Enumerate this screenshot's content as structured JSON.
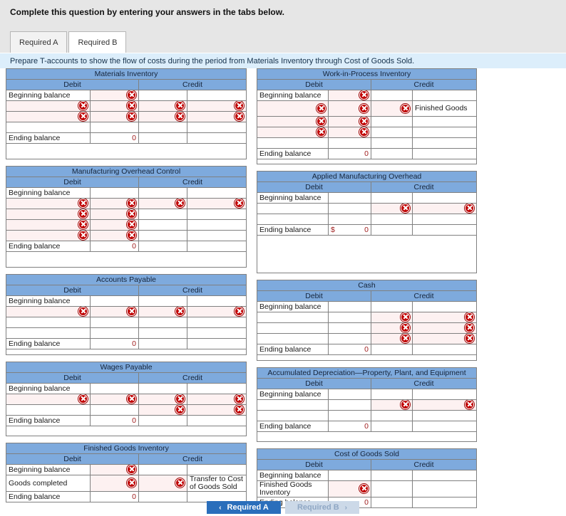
{
  "header": {
    "title": "Complete this question by entering your answers in the tabs below."
  },
  "tabs": [
    {
      "label": "Required A",
      "active": false
    },
    {
      "label": "Required B",
      "active": true
    }
  ],
  "instruction": {
    "text": "Prepare T-accounts to show the flow of costs during the period from Materials Inventory through Cost of Goods Sold."
  },
  "labels": {
    "debit": "Debit",
    "credit": "Credit",
    "beginning_balance": "Beginning balance",
    "ending_balance": "Ending balance",
    "zero": "0",
    "dollar": "$",
    "finished_goods": "Finished Goods",
    "goods_completed": "Goods completed",
    "transfer_to_cogs": "Transfer to Cost of Goods Sold",
    "finished_goods_inventory": "Finished Goods Inventory",
    "empty": ""
  },
  "accounts": {
    "materials_inventory": {
      "title": "Materials Inventory"
    },
    "work_in_process": {
      "title": "Work-in-Process Inventory"
    },
    "mfg_oh_control": {
      "title": "Manufacturing Overhead Control"
    },
    "applied_mfg_oh": {
      "title": "Applied Manufacturing Overhead"
    },
    "accounts_payable": {
      "title": "Accounts Payable"
    },
    "cash": {
      "title": "Cash"
    },
    "wages_payable": {
      "title": "Wages Payable"
    },
    "accum_depr": {
      "title": "Accumulated Depreciation—Property, Plant, and Equipment"
    },
    "finished_goods_inv": {
      "title": "Finished Goods Inventory"
    },
    "cost_of_goods_sold": {
      "title": "Cost of Goods Sold"
    }
  },
  "footer": {
    "prev_label": "Required A",
    "next_label": "Required B",
    "prev_chevron": "‹",
    "next_chevron": "›"
  },
  "icons": {
    "error": "error-x-icon"
  }
}
